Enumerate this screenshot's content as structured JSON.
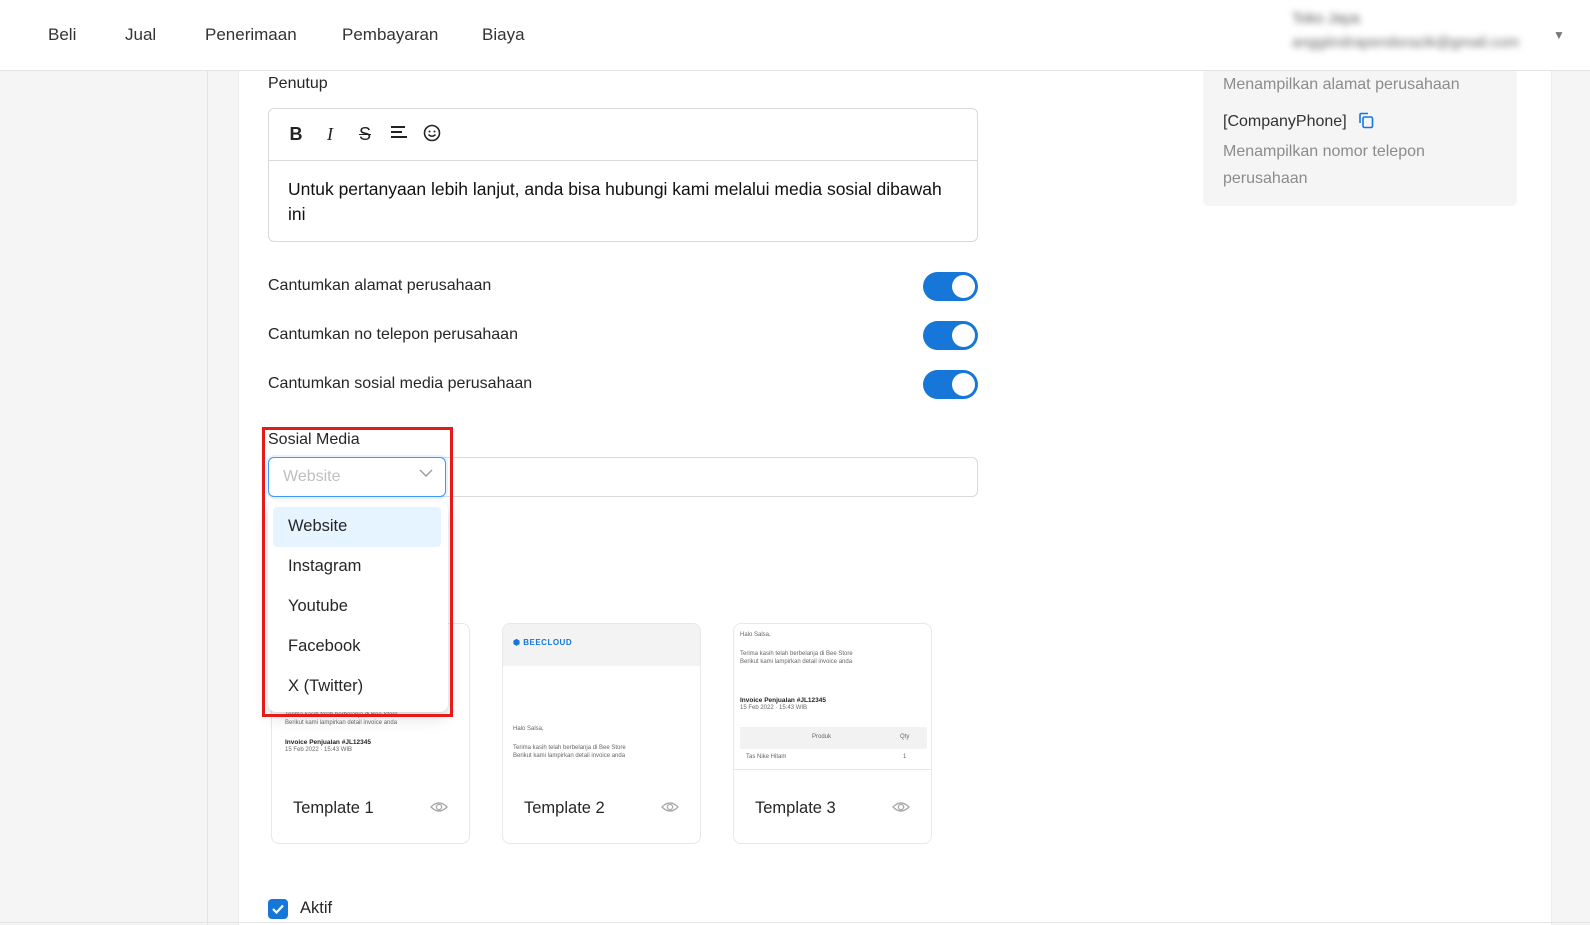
{
  "nav": {
    "items": [
      "Beli",
      "Jual",
      "Penerimaan",
      "Pembayaran",
      "Biaya"
    ]
  },
  "user": {
    "name": "Toko Jaya",
    "email": "anggiindrapendorazik@gmail.com"
  },
  "closing": {
    "label": "Penutup",
    "text": "Untuk pertanyaan lebih lanjut, anda bisa hubungi kami melalui media sosial dibawah ini"
  },
  "toggles": [
    {
      "label": "Cantumkan alamat perusahaan",
      "on": true
    },
    {
      "label": "Cantumkan no telepon perusahaan",
      "on": true
    },
    {
      "label": "Cantumkan sosial media perusahaan",
      "on": true
    }
  ],
  "social": {
    "label": "Sosial Media",
    "placeholder": "Website",
    "options": [
      "Website",
      "Instagram",
      "Youtube",
      "Facebook",
      "X (Twitter)"
    ],
    "active_option": "Website"
  },
  "templates": [
    {
      "name": "Template 1"
    },
    {
      "name": "Template 2"
    },
    {
      "name": "Template 3"
    }
  ],
  "template_preview": {
    "logo": "BEECLOUD",
    "greeting": "Halo Salsa,",
    "thanks": "Terima kasih telah berbelanja di Bee Store",
    "attach": "Berikut kami lampirkan detail invoice anda",
    "invoice_title": "Invoice Penjualan #JL12345",
    "invoice_date": "15 Feb 2022 · 15:43 WIB",
    "col_product": "Produk",
    "col_qty": "Qty",
    "row_product": "Tas Nike Hitam",
    "row_qty": "1"
  },
  "right_panel": {
    "address_desc": "Menampilkan alamat perusahaan",
    "phone_key": "[CompanyPhone]",
    "phone_desc_1": "Menampilkan nomor telepon",
    "phone_desc_2": "perusahaan"
  },
  "active": {
    "label": "Aktif",
    "checked": true
  },
  "colors": {
    "primary": "#1677d9",
    "highlight": "#e31b1b",
    "option_active_bg": "#e6f4ff"
  }
}
